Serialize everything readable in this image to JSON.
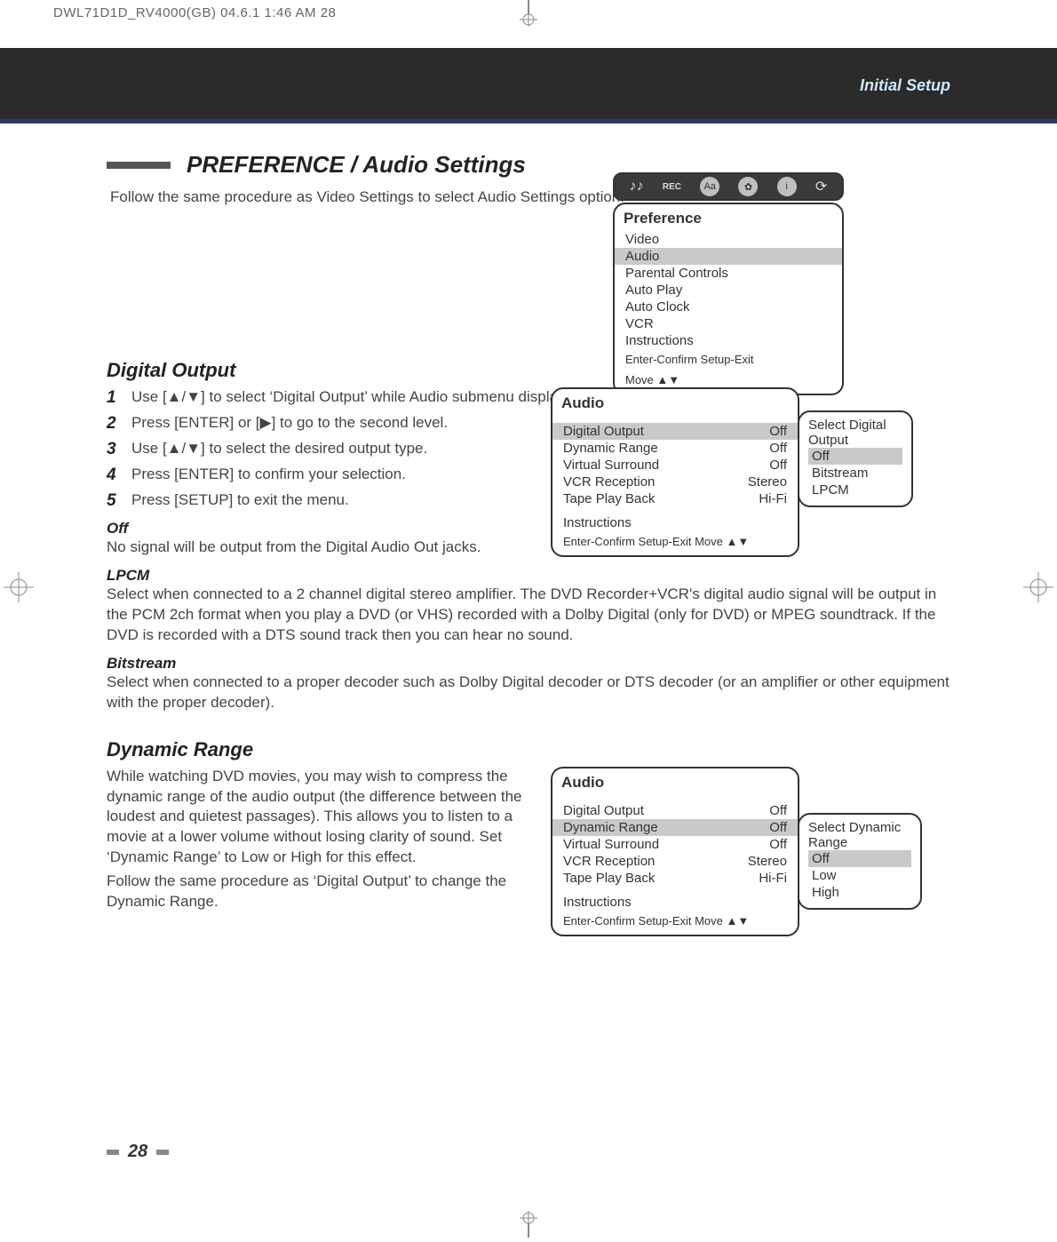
{
  "printer_header": "DWL71D1D_RV4000(GB)  04.6.1 1:46 AM      28",
  "initial_setup_label": "Initial Setup",
  "section_title": "PREFERENCE / Audio Settings",
  "intro_text": "Follow the same procedure as Video Settings to select Audio Settings option.",
  "preference_panel": {
    "title": "Preference",
    "items": [
      "Video",
      "Audio",
      "Parental Controls",
      "Auto Play",
      "Auto Clock",
      "VCR",
      "Instructions"
    ],
    "highlight_index": 1,
    "foot1": "Enter-Confirm   Setup-Exit",
    "foot2": "Move ▲▼"
  },
  "iconstrip": {
    "icons": [
      "mic-icon",
      "rec-icon",
      "aa-badge",
      "fan-icon",
      "info-icon",
      "refresh-icon"
    ],
    "labels": [
      "♪♪",
      "REC",
      "Aa",
      "✿",
      "i",
      "⟳"
    ]
  },
  "digital_output": {
    "heading": "Digital Output",
    "steps": [
      "Use [▲/▼] to select ‘Digital Output’ while Audio submenu displays.",
      "Press [ENTER] or [▶] to go to the second level.",
      "Use [▲/▼] to select the desired output type.",
      "Press [ENTER] to confirm your selection.",
      "Press [SETUP] to exit the menu."
    ],
    "off_title": "Off",
    "off_text": "No signal will be output from the Digital Audio Out jacks.",
    "lpcm_title": "LPCM",
    "lpcm_text": "Select when connected to a 2 channel digital stereo amplifier. The DVD Recorder+VCR's digital audio signal will be output in the PCM 2ch format when you play a DVD (or VHS) recorded with a Dolby Digital (only for DVD) or MPEG soundtrack. If the DVD is recorded with a DTS sound track then you can hear no sound.",
    "bitstream_title": "Bitstream",
    "bitstream_text": "Select when connected to a proper decoder such as Dolby Digital decoder or DTS decoder (or an amplifier or other equipment with the proper decoder)."
  },
  "audio_panel_1": {
    "title": "Audio",
    "rows": [
      {
        "label": "Digital Output",
        "value": "Off",
        "hl": true
      },
      {
        "label": "Dynamic Range",
        "value": "Off",
        "hl": false
      },
      {
        "label": "Virtual Surround",
        "value": "Off",
        "hl": false
      },
      {
        "label": "VCR Reception",
        "value": "Stereo",
        "hl": false
      },
      {
        "label": "Tape Play Back",
        "value": "Hi-Fi",
        "hl": false
      }
    ],
    "instructions": "Instructions",
    "foot": "Enter-Confirm  Setup-Exit  Move ▲▼"
  },
  "popup_1": {
    "title1": "Select Digital",
    "title2": "Output",
    "options": [
      "Off",
      "Bitstream",
      "LPCM"
    ],
    "highlight_index": 0
  },
  "dynamic_range": {
    "heading": "Dynamic Range",
    "text1": "While watching DVD movies, you may wish to compress the dynamic range of the audio output (the difference between the loudest and quietest passages). This allows you to listen to a movie at a lower volume without losing clarity of sound. Set ‘Dynamic Range’ to Low or High for this effect.",
    "text2": "Follow the same procedure as ‘Digital Output’ to change the Dynamic Range."
  },
  "audio_panel_2": {
    "title": "Audio",
    "rows": [
      {
        "label": "Digital Output",
        "value": "Off",
        "hl": false
      },
      {
        "label": "Dynamic Range",
        "value": "Off",
        "hl": true
      },
      {
        "label": "Virtual Surround",
        "value": "Off",
        "hl": false
      },
      {
        "label": "VCR Reception",
        "value": "Stereo",
        "hl": false
      },
      {
        "label": "Tape Play Back",
        "value": "Hi-Fi",
        "hl": false
      }
    ],
    "instructions": "Instructions",
    "foot": "Enter-Confirm  Setup-Exit  Move ▲▼"
  },
  "popup_2": {
    "title1": "Select Dynamic",
    "title2": "Range",
    "options": [
      "Off",
      "Low",
      "High"
    ],
    "highlight_index": 0
  },
  "page_number": "28"
}
